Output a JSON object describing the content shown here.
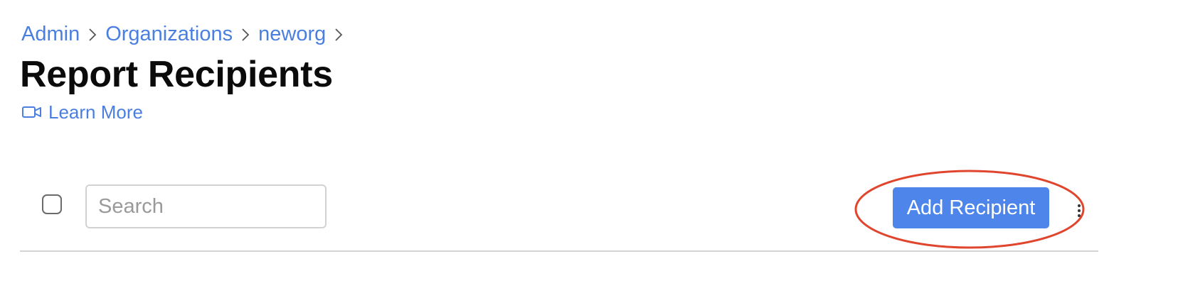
{
  "breadcrumb": {
    "items": [
      "Admin",
      "Organizations",
      "neworg"
    ]
  },
  "page": {
    "title": "Report Recipients",
    "learn_more": "Learn More"
  },
  "toolbar": {
    "search_placeholder": "Search",
    "add_button_label": "Add Recipient"
  },
  "icons": {
    "learn_more": "video-camera-icon",
    "more": "vertical-ellipsis-icon",
    "breadcrumb_separator": "chevron-right-icon"
  },
  "colors": {
    "link": "#4a7fe0",
    "primary_button": "#4d85ea",
    "annotation": "#e0452e"
  }
}
